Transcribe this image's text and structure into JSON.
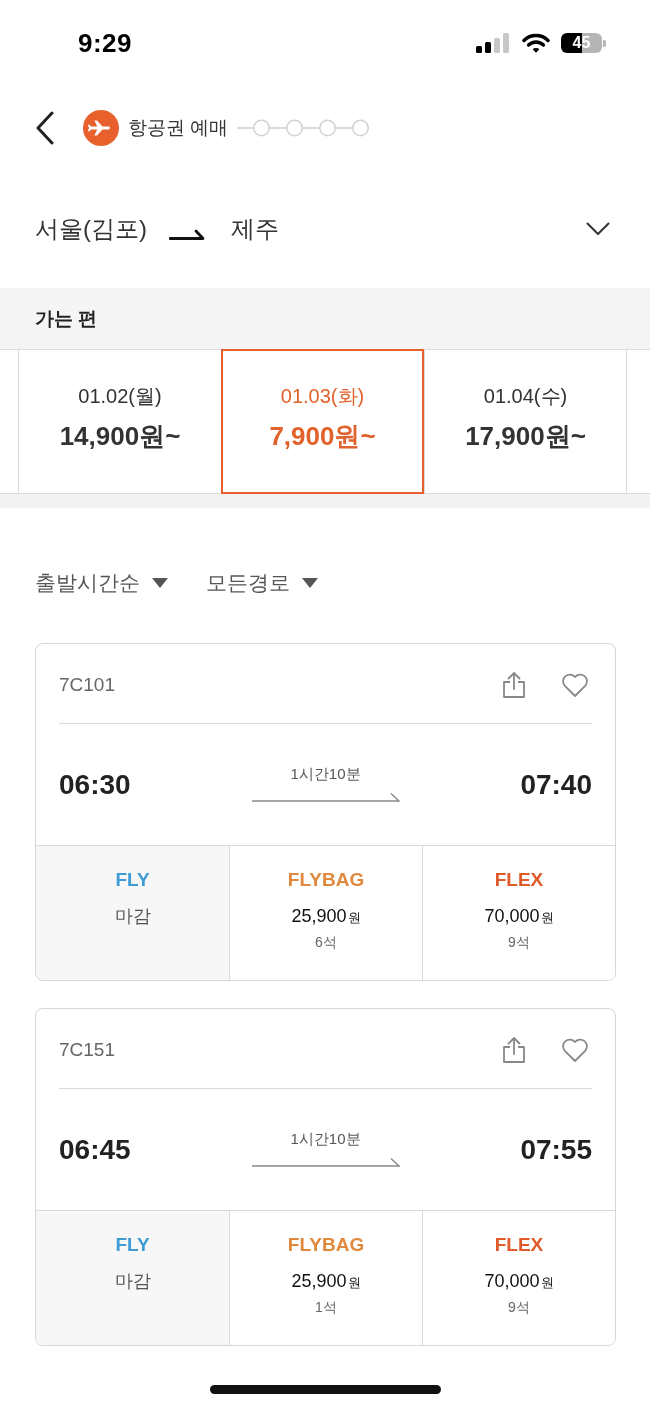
{
  "status_bar": {
    "time": "9:29",
    "battery": "45"
  },
  "header": {
    "title": "항공권 예매",
    "steps": [
      {
        "completed": false
      },
      {
        "completed": false
      },
      {
        "completed": false
      },
      {
        "completed": false
      }
    ]
  },
  "route": {
    "origin": "서울(김포)",
    "destination": "제주"
  },
  "section_title": "가는 편",
  "dates": [
    {
      "date": "01.02(월)",
      "price": "14,900원~",
      "selected": false
    },
    {
      "date": "01.03(화)",
      "price": "7,900원~",
      "selected": true
    },
    {
      "date": "01.04(수)",
      "price": "17,900원~",
      "selected": false
    }
  ],
  "sort_options": [
    {
      "label": "출발시간순"
    },
    {
      "label": "모든경로"
    }
  ],
  "flights": [
    {
      "number": "7C101",
      "favorite": false,
      "departure": "06:30",
      "duration": "1시간10분",
      "arrival": "07:40",
      "fares": [
        {
          "kind": "closed",
          "name": "FLY",
          "color": "#3f9bd4",
          "status": "마감"
        },
        {
          "kind": "available",
          "name": "FLYBAG",
          "color": "#e0883c",
          "price": "25,900",
          "currency": "원",
          "seats": "6석"
        },
        {
          "kind": "available",
          "name": "FLEX",
          "color": "#e05a2a",
          "price": "70,000",
          "currency": "원",
          "seats": "9석"
        }
      ]
    },
    {
      "number": "7C151",
      "favorite": false,
      "departure": "06:45",
      "duration": "1시간10분",
      "arrival": "07:55",
      "fares": [
        {
          "kind": "closed",
          "name": "FLY",
          "color": "#3f9bd4",
          "status": "마감"
        },
        {
          "kind": "available",
          "name": "FLYBAG",
          "color": "#e0883c",
          "price": "25,900",
          "currency": "원",
          "seats": "1석"
        },
        {
          "kind": "available",
          "name": "FLEX",
          "color": "#e05a2a",
          "price": "70,000",
          "currency": "원",
          "seats": "9석"
        }
      ]
    }
  ]
}
